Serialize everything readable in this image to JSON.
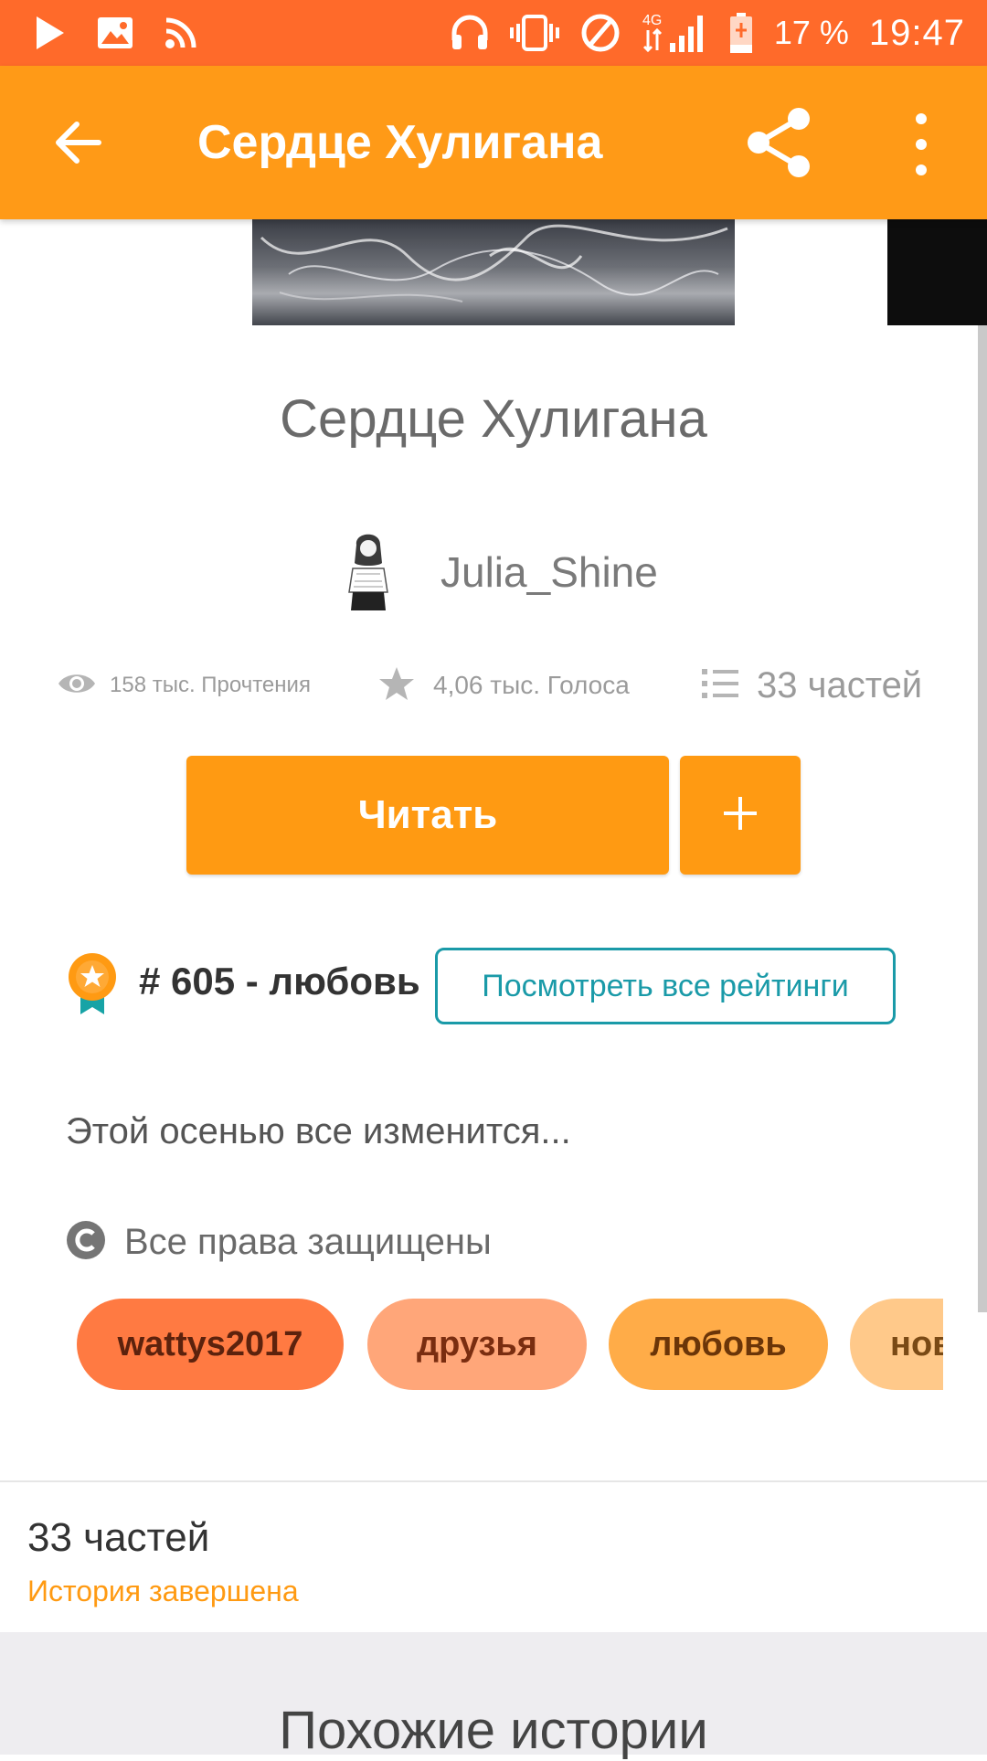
{
  "status_bar": {
    "battery": "17 %",
    "time": "19:47",
    "network": "4G",
    "icons": [
      "play-store-icon",
      "gallery-icon",
      "rss-icon",
      "headphones-icon",
      "vibrate-icon",
      "no-sim-icon",
      "signal-icon",
      "battery-icon"
    ]
  },
  "app_bar": {
    "title": "Сердце Хулигана",
    "icons": [
      "back-arrow-icon",
      "share-icon",
      "more-vert-icon"
    ]
  },
  "story": {
    "title": "Сердце Хулигана",
    "author": "Julia_Shine",
    "stats": {
      "reads": "158 тыс. Прочтения",
      "votes": "4,06 тыс. Голоса",
      "parts": "33 частей"
    },
    "read_button": "Читать",
    "add_button": "+",
    "rank": "# 605 - любовь",
    "ratings_button": "Посмотреть все рейтинги",
    "description": "Этой осенью все изменится...",
    "copyright": "Все права защищены",
    "tags": [
      "wattys2017",
      "друзья",
      "любовь",
      "нов"
    ],
    "parts_count": "33 частей",
    "parts_status": "История завершена"
  },
  "similar": {
    "title": "Похожие истории"
  },
  "colors": {
    "status_bar": "#ff6a2a",
    "app_bar": "#ff9a17",
    "accent": "#ff9a12",
    "link": "#1a9aa8",
    "tags": [
      "#ff7a42",
      "#ffa679",
      "#ffac48",
      "#ffc98a"
    ],
    "tag_text": [
      "#5c220d",
      "#7a2d10",
      "#6b3508",
      "#7a4a15"
    ]
  }
}
